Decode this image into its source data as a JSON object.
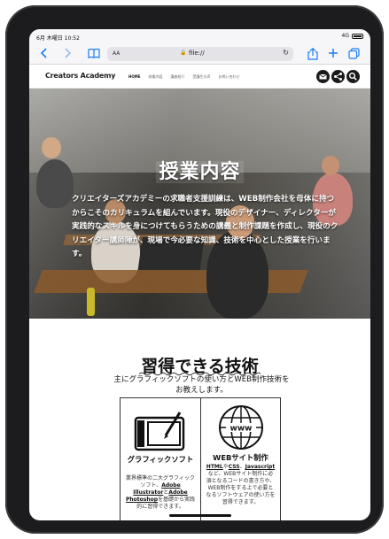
{
  "status_bar": {
    "time_date": "6月 木曜日 10:52",
    "signal": "4G",
    "battery": "battery"
  },
  "toolbar": {
    "back_icon": "chevron-left-icon",
    "forward_icon": "chevron-right-icon",
    "bookmarks_icon": "book-icon",
    "text_size_label": "AA",
    "address": "file://",
    "share_icon": "share-icon",
    "new_tab_icon": "plus-icon",
    "tabs_icon": "tabs-icon"
  },
  "site_nav": {
    "logo": "Creators Academy",
    "links": [
      "HOME",
      "授業内容",
      "講座紹介",
      "受講生の声",
      "お問い合わせ"
    ],
    "buttons": [
      "mail-icon",
      "share-icon",
      "search-icon"
    ]
  },
  "hero": {
    "title": "授業内容",
    "text": "クリエイターズアカデミーの求職者支援訓練は、WEB制作会社を母体に持つからこそのカリキュラムを組んでいます。現役のデザイナー、ディレクターが実践的なスキルを身につけてもらうための講義と制作課題を作成し、現役のクリエイター講師陣が、現場で今必要な知識、技術を中心とした授業を行います。"
  },
  "skills": {
    "title": "習得できる技術",
    "subtitle": "主にグラフィックソフトの使い方とWEB制作技術をお教えします。",
    "cards": [
      {
        "icon": "graphics-tablet-icon",
        "title": "グラフィックソフト",
        "body_1": "業界標準の二大グラフィックソフト、",
        "em_1": "Adobe Illustrator",
        "body_2": "と",
        "em_2": "Adobe Photoshop",
        "body_3": "を基礎から実践的に習得できます。"
      },
      {
        "icon": "globe-www-icon",
        "title": "WEBサイト制作",
        "em_1": "HTML",
        "body_1": "や",
        "em_2": "CSS",
        "body_2": "、",
        "em_3": "Javascript",
        "body_3": "など、WEBサイト制作に必須となるコードの書き方や、WEB制作をする上で必要となるソフトウェアの使い方を習得できます。"
      }
    ]
  }
}
